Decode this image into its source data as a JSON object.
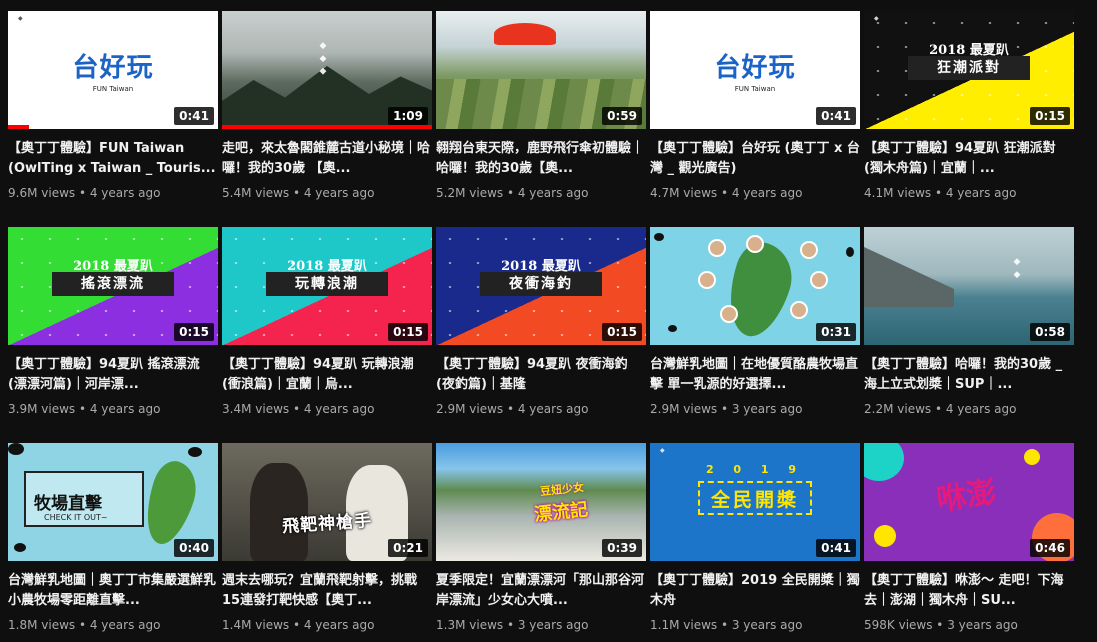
{
  "videos": [
    {
      "title": "【奧丁丁體驗】FUN Taiwan (OwlTing x Taiwan _ Touris...",
      "views": "9.6M views",
      "age": "4 years ago",
      "duration": "0:41",
      "watched_fraction": 0.1,
      "thumb_text": "台好玩",
      "thumb_sub": "FUN Taiwan"
    },
    {
      "title": "走吧，來太魯閣錐麓古道小秘境｜哈囉！我的30歲 【奧...",
      "views": "5.4M views",
      "age": "4 years ago",
      "duration": "1:09",
      "watched_fraction": 1.0
    },
    {
      "title": "翱翔台東天際，鹿野飛行傘初體驗｜哈囉！我的30歲【奧...",
      "views": "5.2M views",
      "age": "4 years ago",
      "duration": "0:59"
    },
    {
      "title": "【奧丁丁體驗】台好玩 (奧丁丁 x 台灣 _ 觀光廣告)",
      "views": "4.7M views",
      "age": "4 years ago",
      "duration": "0:41",
      "thumb_text": "台好玩",
      "thumb_sub": "FUN Taiwan"
    },
    {
      "title": "【奧丁丁體驗】94夏趴 狂潮派對　(獨木舟篇)｜宜蘭｜...",
      "views": "4.1M views",
      "age": "4 years ago",
      "duration": "0:15",
      "thumb_year": "2018 最夏趴",
      "thumb_text": "狂潮派對",
      "colors": [
        "#ffee00",
        "#111111"
      ]
    },
    {
      "title": "【奧丁丁體驗】94夏趴 搖滾漂流　(漂漂河篇)｜河岸漂...",
      "views": "3.9M views",
      "age": "4 years ago",
      "duration": "0:15",
      "thumb_year": "2018 最夏趴",
      "thumb_text": "搖滾漂流",
      "colors": [
        "#8b2fe0",
        "#33dd33"
      ]
    },
    {
      "title": "【奧丁丁體驗】94夏趴 玩轉浪潮　(衝浪篇)｜宜蘭｜烏...",
      "views": "3.4M views",
      "age": "4 years ago",
      "duration": "0:15",
      "thumb_year": "2018 最夏趴",
      "thumb_text": "玩轉浪潮",
      "colors": [
        "#f5244f",
        "#1ec8c8"
      ]
    },
    {
      "title": "【奧丁丁體驗】94夏趴 夜衝海釣　(夜釣篇)｜基隆",
      "views": "2.9M views",
      "age": "4 years ago",
      "duration": "0:15",
      "thumb_year": "2018 最夏趴",
      "thumb_text": "夜衝海釣",
      "colors": [
        "#f24a22",
        "#1a2a8c"
      ]
    },
    {
      "title": "台灣鮮乳地圖｜在地優質酪農牧場直擊 單一乳源的好選擇...",
      "views": "2.9M views",
      "age": "3 years ago",
      "duration": "0:31"
    },
    {
      "title": "【奧丁丁體驗】哈囉！我的30歲 _ 海上立式划槳｜SUP｜...",
      "views": "2.2M views",
      "age": "4 years ago",
      "duration": "0:58"
    },
    {
      "title": "台灣鮮乳地圖｜奧丁丁市集嚴選鮮乳 小農牧場零距離直擊...",
      "views": "1.8M views",
      "age": "4 years ago",
      "duration": "0:40",
      "thumb_text": "牧場直擊",
      "thumb_sub": "CHECK IT OUT~"
    },
    {
      "title": "週末去哪玩？宜蘭飛靶射擊，挑戰15連發打靶快感【奧丁...",
      "views": "1.4M views",
      "age": "4 years ago",
      "duration": "0:21",
      "thumb_text": "飛靶神槍手"
    },
    {
      "title": "夏季限定！宜蘭漂漂河「那山那谷河岸漂流」少女心大噴...",
      "views": "1.3M views",
      "age": "3 years ago",
      "duration": "0:39",
      "thumb_text": "漂流記",
      "thumb_sub": "豆妞少女"
    },
    {
      "title": "【奧丁丁體驗】2019 全民開槳｜獨木舟",
      "views": "1.1M views",
      "age": "3 years ago",
      "duration": "0:41",
      "thumb_year": "2 0 1 9",
      "thumb_text": "全民開槳"
    },
    {
      "title": "【奧丁丁體驗】咻澎～ 走吧！下海去｜澎湖｜獨木舟｜SU...",
      "views": "598K views",
      "age": "3 years ago",
      "duration": "0:46",
      "thumb_text": "咻澎"
    }
  ]
}
